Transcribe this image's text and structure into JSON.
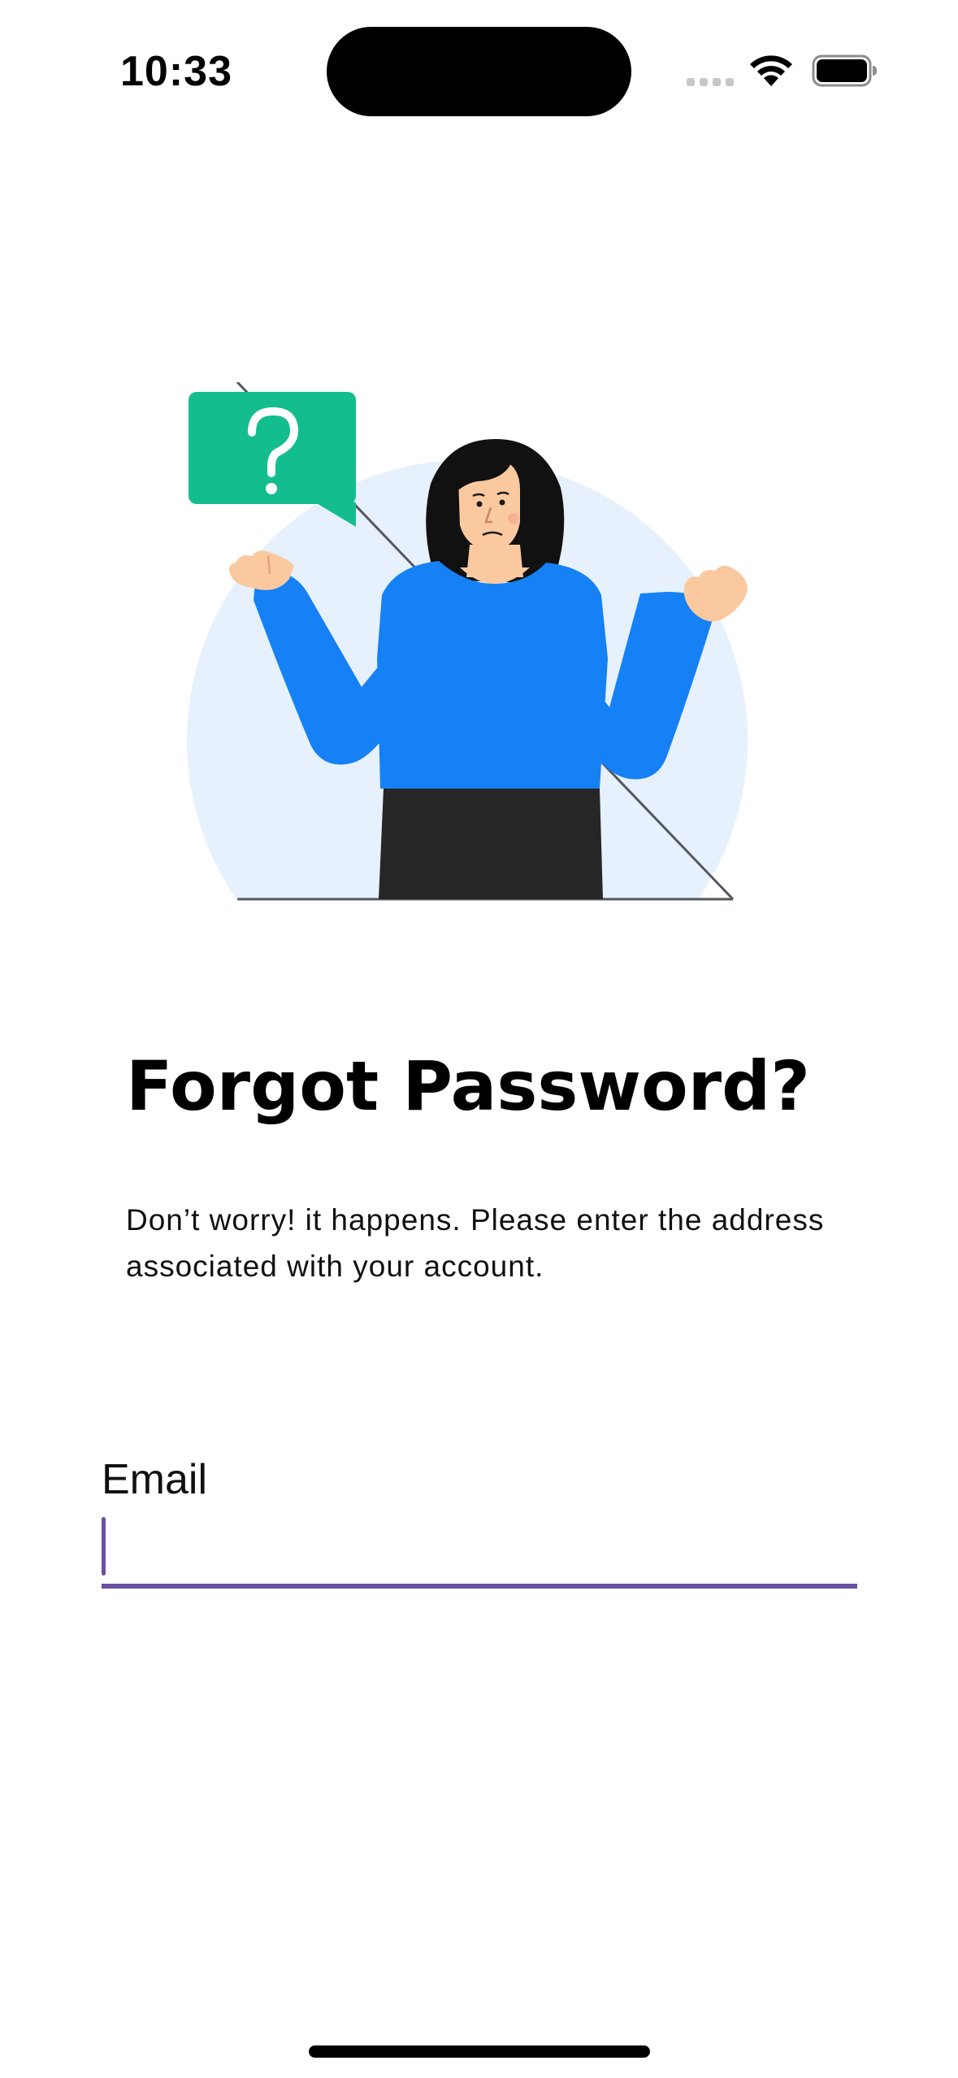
{
  "status_bar": {
    "time": "10:33"
  },
  "illustration": {
    "name": "confused-woman-illustration",
    "bubble_symbol": "?",
    "colors": {
      "circle": "#e6f1fd",
      "shirt": "#1581f5",
      "skirt": "#262626",
      "hair": "#111111",
      "skin": "#fbc9a0",
      "bubble": "#13bd8e"
    }
  },
  "content": {
    "title": "Forgot Password?",
    "description": "Don’t worry! it happens. Please enter the address associated with your account."
  },
  "form": {
    "email_label": "Email",
    "email_value": "",
    "accent_color": "#6750a4"
  }
}
